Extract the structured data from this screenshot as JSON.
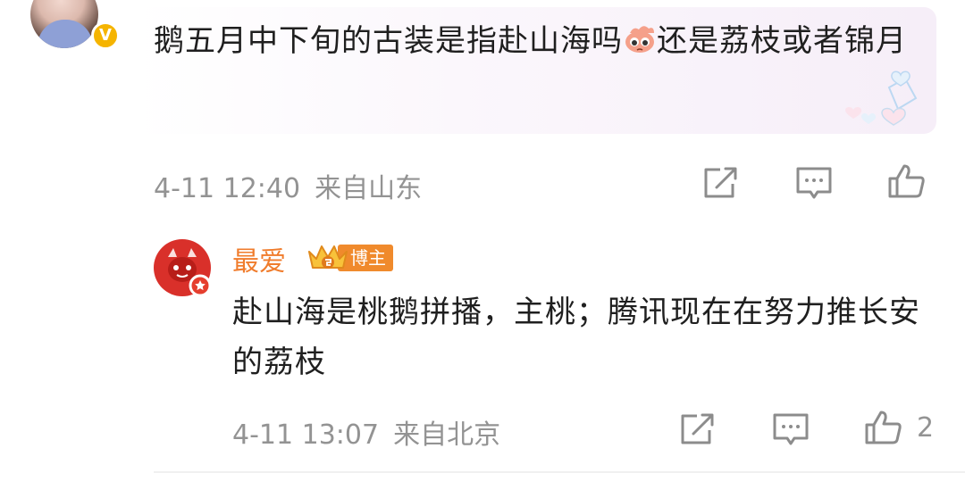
{
  "comment": {
    "badge": "V",
    "text_before_emoji": "鹅五月中下旬的古装是指赴山海吗",
    "emoji_name": "sad-face-emoji",
    "text_after_emoji": "还是荔枝或者锦月",
    "time": "4-11 12:40",
    "location": "来自山东"
  },
  "reply": {
    "username": "最爱",
    "role_badge": "博主",
    "text": "赴山海是桃鹅拼播，主桃；腾讯现在在努力推长安的荔枝",
    "time": "4-11 13:07",
    "location": "来自北京",
    "like_count": "2"
  },
  "icons": {
    "share": "share-icon",
    "comment": "comment-icon",
    "like": "like-icon"
  },
  "colors": {
    "username": "#f07c2c",
    "meta": "#939393",
    "verified": "#f5b400",
    "avatar_red": "#d9302a"
  }
}
